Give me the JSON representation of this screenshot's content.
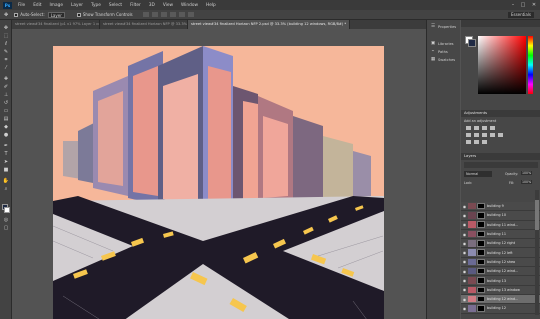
{
  "app": {
    "logo": "Ps"
  },
  "menu": [
    "File",
    "Edit",
    "Image",
    "Layer",
    "Type",
    "Select",
    "Filter",
    "3D",
    "View",
    "Window",
    "Help"
  ],
  "window_controls": [
    "minimize-icon",
    "maximize-icon",
    "close-icon"
  ],
  "options_bar": {
    "auto_select_label": "Auto-Select:",
    "auto_select_value": "Layer",
    "transform_label": "Show Transform Controls",
    "workspace": "Essentials"
  },
  "tabs": [
    {
      "label": "street view#34 finalized (p1 v1 97% Layer 1 copy, RGB/8#) *",
      "active": false
    },
    {
      "label": "street view#34 finalized Horizon NFP @ 33.3% (guideline 1 ...",
      "active": false
    },
    {
      "label": "street view#34 finalized Horizon NFP 2.psd @ 33.3% (building 12 windows, RGB/8#) *",
      "active": true
    }
  ],
  "right_collapsed": [
    {
      "icon": "properties-icon",
      "label": "Properties"
    },
    {
      "icon": "libraries-icon",
      "label": "Libraries"
    },
    {
      "icon": "paths-icon",
      "label": "Paths"
    },
    {
      "icon": "swatches-icon",
      "label": "Swatches"
    }
  ],
  "panels": {
    "adjustments_title": "Adjustments",
    "adjustments_hint": "Add an adjustment",
    "layers_title": "Layers",
    "blend_mode": "Normal",
    "opacity_label": "Opacity:",
    "opacity_value": "100%",
    "lock_label": "Lock:",
    "fill_label": "Fill:",
    "fill_value": "100%"
  },
  "layers": [
    {
      "name": "building 9",
      "thumb": "#7a4a52",
      "selected": false
    },
    {
      "name": "building 10",
      "thumb": "#6a4450",
      "selected": false
    },
    {
      "name": "building 11 wind...",
      "thumb": "#b85a66",
      "selected": false
    },
    {
      "name": "building 11",
      "thumb": "#8a5060",
      "selected": false
    },
    {
      "name": "building 12 right",
      "thumb": "#7a6e7e",
      "selected": false
    },
    {
      "name": "building 12 left",
      "thumb": "#8c8cb0",
      "selected": false
    },
    {
      "name": "building 12 shea",
      "thumb": "#6a6a94",
      "selected": false
    },
    {
      "name": "building 12 wind...",
      "thumb": "#5a5a80",
      "selected": false
    },
    {
      "name": "building 13",
      "thumb": "#7a4a52",
      "selected": false
    },
    {
      "name": "building 13 window",
      "thumb": "#b85a66",
      "selected": false
    },
    {
      "name": "building 12 wind...",
      "thumb": "#d07c84",
      "selected": true
    },
    {
      "name": "building 12",
      "thumb": "#7a6e92",
      "selected": false
    }
  ],
  "colors": {
    "sky": "#f6b79a",
    "road": "#1f1a28",
    "sidewalk": "#d3cfd2",
    "lane_mark": "#f6c64e",
    "building_pink": "#e89a8e",
    "building_purple": "#8c8cc8"
  }
}
